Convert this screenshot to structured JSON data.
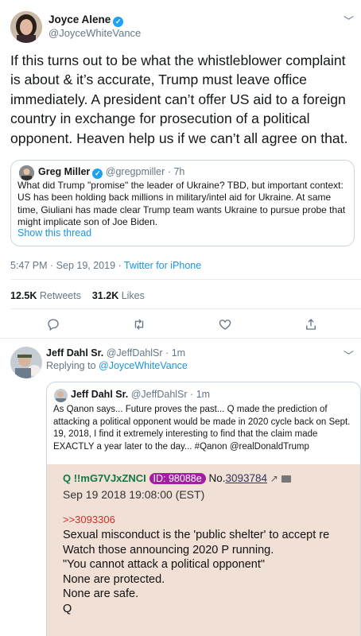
{
  "tweet": {
    "author_name": "Joyce Alene",
    "author_handle": "@JoyceWhiteVance",
    "text": "If this turns out to be what the whistleblower complaint is about & it’s accurate, Trump must leave office immediately. A president can’t offer US aid to a foreign country in exchange for prosecution of a political opponent. Heaven help us if we can’t all agree on that.",
    "quoted": {
      "author_name": "Greg Miller",
      "author_handle": "@gregpmiller",
      "time": "7h",
      "text": "What did Trump \"promise\" the leader of Ukraine? TBD, but important context: US has been holding back millions in military/intel aid for Ukraine. At same time, Giuliani has made clear Trump team wants Ukraine to pursue probe that might implicate son of Joe Biden.",
      "show_thread": "Show this thread"
    },
    "timestamp": "5:47 PM · Sep 19, 2019 ·",
    "source": "Twitter for iPhone",
    "retweets_count": "12.5K",
    "retweets_label": "Retweets",
    "likes_count": "31.2K",
    "likes_label": "Likes"
  },
  "reply": {
    "author_name": "Jeff Dahl Sr.",
    "author_handle": "@JeffDahlSr",
    "time": "1m",
    "replying_prefix": "Replying to",
    "replying_handle": "@JoyceWhiteVance",
    "quoted": {
      "author_name": "Jeff Dahl Sr.",
      "author_handle": "@JeffDahlSr",
      "time": "1m",
      "text": "As Qanon says... Future proves the past... Q made the prediction of attacking a political opponent would be made in 2020 cycle back on Sept. 19, 2018, I find it extremely interesting to find that the claim made EXACTLY a year later to the day... #Qanon @realDonaldTrump",
      "q_post": {
        "header_name": "Q !!mG7VJxZNCI",
        "id_label": "ID: 98088e",
        "no_label": "No.",
        "no_value": "3093784",
        "date": "Sep 19 2018 19:08:00 (EST)",
        "ref": ">>3093306",
        "lines": [
          "Sexual misconduct is the 'public shelter' to accept re",
          "Watch those announcing 2020 P running.",
          "\"You cannot attack a political opponent\"",
          "None are protected.",
          "None are safe.",
          "Q"
        ]
      }
    }
  },
  "colors": {
    "accent": "#1b95e0",
    "verified": "#1da1f2",
    "id_badge": "#a020a0",
    "q_ref": "#d0312d"
  },
  "icons": [
    "reply-icon",
    "retweet-icon",
    "like-icon",
    "share-icon",
    "chevron-down-icon",
    "verified-icon"
  ]
}
